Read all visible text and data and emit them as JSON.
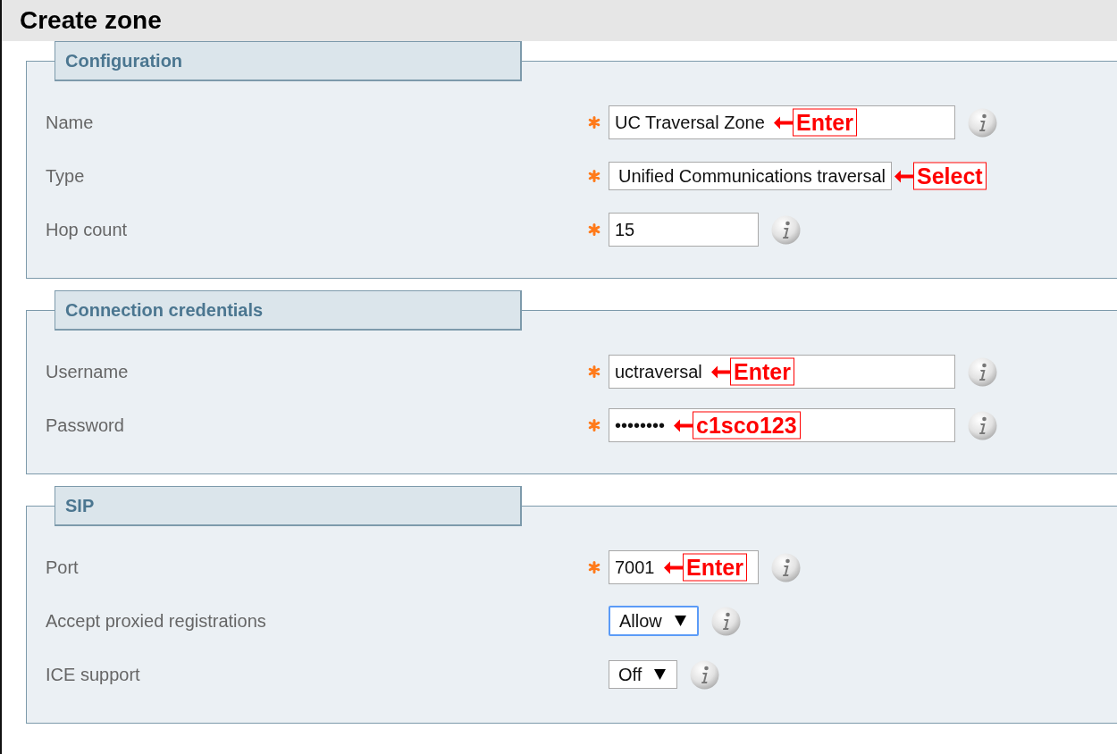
{
  "page": {
    "title": "Create zone"
  },
  "sections": [
    {
      "title": "Configuration",
      "rows": [
        {
          "label": "Name",
          "required": true,
          "kind": "text",
          "value": "UC Traversal Zone",
          "annotation": "Enter",
          "info": true
        },
        {
          "label": "Type",
          "required": true,
          "kind": "select",
          "value": "Unified Communications traversal",
          "annotation": "Select",
          "info": false,
          "focused": false
        },
        {
          "label": "Hop count",
          "required": true,
          "kind": "number",
          "value": "15",
          "info": true
        }
      ]
    },
    {
      "title": "Connection credentials",
      "rows": [
        {
          "label": "Username",
          "required": true,
          "kind": "text",
          "value": "uctraversal",
          "annotation": "Enter",
          "info": true
        },
        {
          "label": "Password",
          "required": true,
          "kind": "text",
          "value": "••••••••",
          "annotation": "c1sco123",
          "info": true
        }
      ]
    },
    {
      "title": "SIP",
      "rows": [
        {
          "label": "Port",
          "required": true,
          "kind": "number",
          "value": "7001",
          "annotation": "Enter",
          "info": true
        },
        {
          "label": "Accept proxied registrations",
          "required": false,
          "kind": "select",
          "value": "Allow",
          "info": true,
          "focused": true
        },
        {
          "label": "ICE support",
          "required": false,
          "kind": "select",
          "value": "Off",
          "info": true,
          "focused": false
        }
      ]
    }
  ]
}
